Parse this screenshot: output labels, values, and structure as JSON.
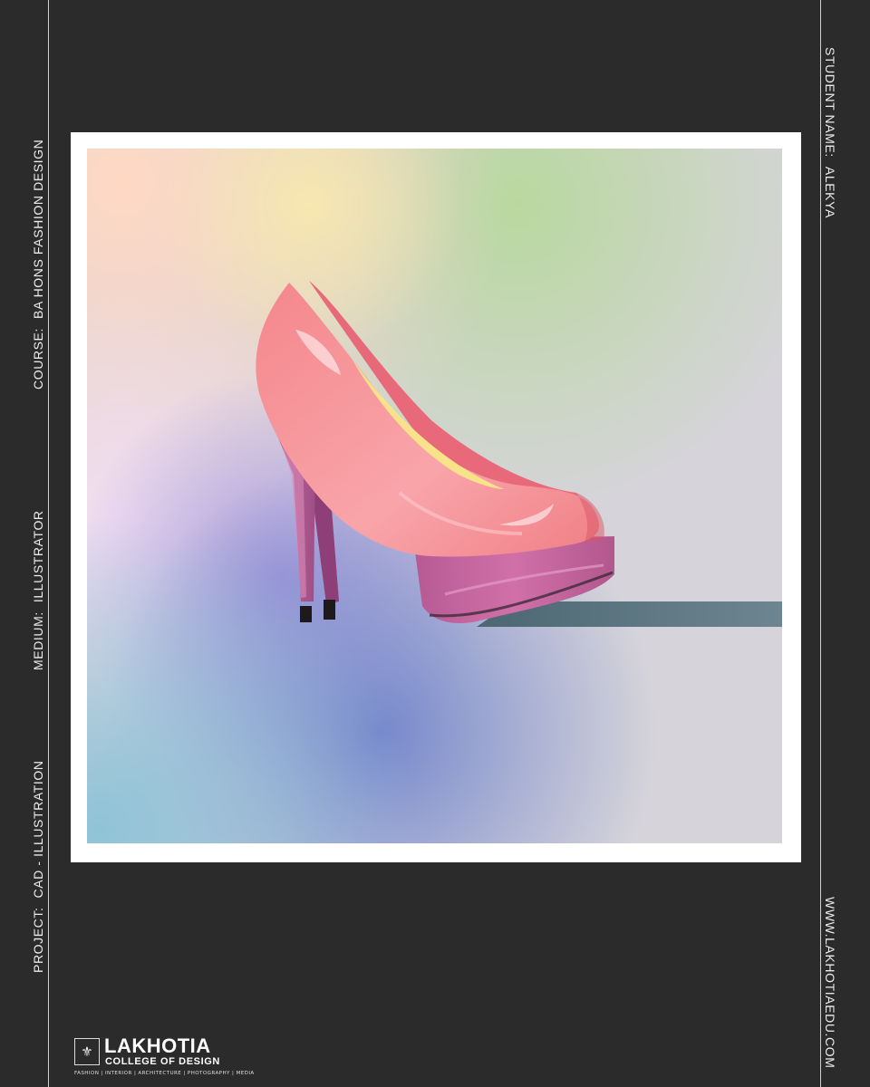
{
  "left_labels": {
    "project": {
      "label": "PROJECT:",
      "value": "CAD - ILLUSTRATION"
    },
    "medium": {
      "label": "MEDIUM:",
      "value": "ILLUSTRATOR"
    },
    "course": {
      "label": "COURSE:",
      "value": "BA HONS FASHION DESIGN"
    }
  },
  "right_labels": {
    "student": {
      "label": "STUDENT NAME:",
      "value": "ALEKYA"
    },
    "website": "WWW.LAKHOTIAEDU.COM"
  },
  "logo": {
    "name": "LAKHOTIA",
    "subtitle": "COLLEGE OF DESIGN",
    "tagline": "FASHION | INTERIOR | ARCHITECTURE | PHOTOGRAPHY | MEDIA"
  },
  "colors": {
    "background": "#2b2b2b",
    "frame": "#ffffff",
    "shoe_pink": "#f07f86",
    "sole_magenta": "#c45f99"
  },
  "icons": {
    "logo_mark": "crest-icon"
  }
}
